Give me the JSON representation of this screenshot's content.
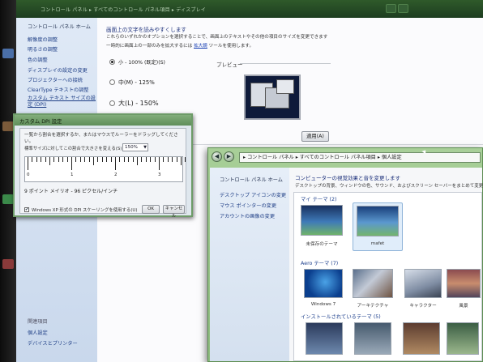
{
  "back_window": {
    "title": "コントロール パネル ▸ すべてのコントロール パネル項目 ▸ ディスプレイ",
    "sidebar": {
      "home": "コントロール パネル ホーム",
      "items": [
        "解像度の調整",
        "明るさの調整",
        "色の調整",
        "ディスプレイの設定の変更",
        "プロジェクターへの接続",
        "ClearType テキストの調整",
        "カスタム テキスト サイズの設定 (DPI)"
      ],
      "footer": [
        "関連項目",
        "個人設定",
        "デバイスとプリンター"
      ]
    },
    "main": {
      "title": "画面上の文字を読みやすくします",
      "description": "これらのいずれかのオプションを選択することで、画面上のテキストやその他の項目のサイズを変更できます",
      "description2_prefix": "一時的に画面上の一部のみを拡大するには",
      "magnifier_link": "拡大鏡",
      "description2_suffix": "ツールを使用します。",
      "options": [
        {
          "label": "小 - 100% (既定)(S)",
          "checked": true
        },
        {
          "label": "中(M) - 125%",
          "checked": false
        },
        {
          "label": "大(L) - 150%",
          "checked": false
        }
      ],
      "preview_label": "プレビュー",
      "apply_button": "適用(A)"
    }
  },
  "dpi_dialog": {
    "title": "カスタム DPI 設定",
    "instruction": "一覧から割合を選択するか、またはマウスでルーラーをドラッグしてください。",
    "scale_label": "標準サイズに対してこの割合で大きさを変える(S):",
    "scale_value": "150%",
    "ruler_numbers": [
      "0",
      "1",
      "2",
      "3"
    ],
    "sample_text": "9 ポイント メイリオ - 96 ピクセル/インチ",
    "xp_scaling_label": "Windows XP 形式の DPI スケーリングを使用する(U)",
    "xp_scaling_checked": true,
    "ok_button": "OK",
    "cancel_button": "キャンセル"
  },
  "front_window": {
    "breadcrumb": "▸ コントロール パネル ▸ すべてのコントロール パネル項目 ▸ 個人設定",
    "sidebar": {
      "home": "コントロール パネル ホーム",
      "items": [
        "デスクトップ アイコンの変更",
        "マウス ポインターの変更",
        "アカウントの画像の変更"
      ]
    },
    "heading": "コンピューターの視覚効果と音を変更します",
    "description": "デスクトップの背景、ウィンドウの色、サウンド、およびスクリーン セーバーをまとめて変更",
    "sections": {
      "my_themes": "マイ テーマ (2)",
      "aero_themes": "Aero テーマ (7)",
      "installed_themes": "インストールされているテーマ (5)"
    },
    "my_themes": [
      {
        "name": "未保存のテーマ",
        "selected": false
      },
      {
        "name": "mafet",
        "selected": true
      }
    ],
    "aero_themes": [
      {
        "name": "Windows 7"
      },
      {
        "name": "アーキテクチャ"
      },
      {
        "name": "キャラクター"
      },
      {
        "name": "風景"
      }
    ]
  },
  "colors": {
    "green_accent": "#6d9b68",
    "link_blue": "#1f3f86"
  }
}
